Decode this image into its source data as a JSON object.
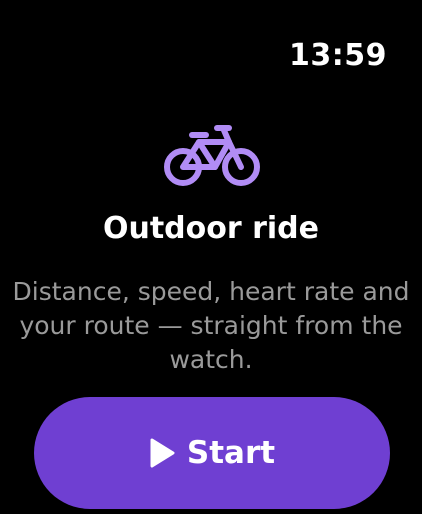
{
  "status_bar": {
    "time": "13:59"
  },
  "workout": {
    "icon": "bicycle-icon",
    "title": "Outdoor ride",
    "description": "Distance, speed, heart rate and your route — straight from the watch."
  },
  "start_button": {
    "label": "Start",
    "icon": "play-icon"
  },
  "colors": {
    "background": "#000000",
    "accent": "#6f3fd2",
    "icon": "#b18cf5",
    "text_secondary": "#9a9a9a"
  }
}
